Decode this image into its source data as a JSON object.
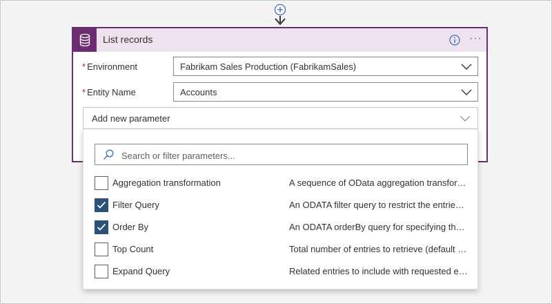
{
  "card": {
    "title": "List records",
    "icons": {
      "service": "database-icon",
      "info": "info-icon",
      "more": "more-options-icon",
      "add_step": "plus-circle-icon"
    },
    "more_label": "···"
  },
  "fields": {
    "environment": {
      "label": "Environment",
      "required_mark": "*",
      "value": "Fabrikam Sales Production (FabrikamSales)"
    },
    "entity_name": {
      "label": "Entity Name",
      "required_mark": "*",
      "value": "Accounts"
    }
  },
  "add_parameter": {
    "label": "Add new parameter"
  },
  "parameter_panel": {
    "search_placeholder": "Search or filter parameters...",
    "options": [
      {
        "label": "Aggregation transformation",
        "description": "A sequence of OData aggregation transformations separated by '/'",
        "checked": false
      },
      {
        "label": "Filter Query",
        "description": "An ODATA filter query to restrict the entries returned",
        "checked": true
      },
      {
        "label": "Order By",
        "description": "An ODATA orderBy query for specifying the order of entries",
        "checked": true
      },
      {
        "label": "Top Count",
        "description": "Total number of entries to retrieve (default = all)",
        "checked": false
      },
      {
        "label": "Expand Query",
        "description": "Related entries to include with requested entries",
        "checked": false
      }
    ]
  },
  "colors": {
    "accent": "#6b2d70",
    "header_bg": "#efe2ef",
    "checkbox_checked": "#2b5278",
    "link_blue": "#3a6fb5"
  }
}
